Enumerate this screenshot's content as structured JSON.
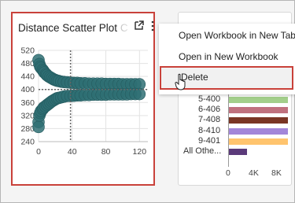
{
  "left_card": {
    "title_visible": "Distance Scatter Plot",
    "title_faded": " C",
    "icons": [
      "expand-icon",
      "kebab-menu-icon"
    ]
  },
  "chart_data": {
    "type": "scatter",
    "title": "Distance Scatter Plot",
    "xlim": [
      0,
      130
    ],
    "ylim": [
      240,
      520
    ],
    "xticks": [
      "0",
      "40",
      "80",
      "120"
    ],
    "yticks": [
      "520",
      "480",
      "440",
      "400",
      "360",
      "320",
      "280",
      "240"
    ],
    "grid": true,
    "reference_lines": {
      "x": 38,
      "y": 400
    },
    "color": "#2e6e73",
    "points": [
      [
        0,
        490
      ],
      [
        1,
        478
      ],
      [
        2,
        470
      ],
      [
        3,
        466
      ],
      [
        5,
        460
      ],
      [
        6,
        456
      ],
      [
        7,
        452
      ],
      [
        9,
        447
      ],
      [
        10,
        444
      ],
      [
        12,
        440
      ],
      [
        14,
        437
      ],
      [
        16,
        434
      ],
      [
        18,
        431
      ],
      [
        20,
        429
      ],
      [
        22,
        427
      ],
      [
        24,
        426
      ],
      [
        27,
        424
      ],
      [
        30,
        423
      ],
      [
        34,
        422
      ],
      [
        38,
        421
      ],
      [
        42,
        420
      ],
      [
        46,
        420
      ],
      [
        50,
        419
      ],
      [
        55,
        419
      ],
      [
        60,
        418
      ],
      [
        65,
        418
      ],
      [
        70,
        418
      ],
      [
        75,
        418
      ],
      [
        80,
        417
      ],
      [
        85,
        417
      ],
      [
        90,
        417
      ],
      [
        95,
        417
      ],
      [
        100,
        416
      ],
      [
        105,
        416
      ],
      [
        110,
        416
      ],
      [
        115,
        416
      ],
      [
        120,
        416
      ],
      [
        0,
        300
      ],
      [
        0,
        285
      ],
      [
        1,
        320
      ],
      [
        2,
        328
      ],
      [
        3,
        334
      ],
      [
        5,
        340
      ],
      [
        6,
        344
      ],
      [
        8,
        348
      ],
      [
        10,
        352
      ],
      [
        12,
        356
      ],
      [
        14,
        360
      ],
      [
        16,
        364
      ],
      [
        18,
        367
      ],
      [
        20,
        370
      ],
      [
        22,
        373
      ],
      [
        24,
        374
      ],
      [
        27,
        376
      ],
      [
        30,
        378
      ],
      [
        34,
        380
      ],
      [
        38,
        380
      ],
      [
        42,
        381
      ],
      [
        46,
        382
      ],
      [
        50,
        382
      ],
      [
        55,
        383
      ],
      [
        60,
        383
      ],
      [
        65,
        384
      ],
      [
        70,
        384
      ],
      [
        75,
        384
      ],
      [
        80,
        384
      ],
      [
        85,
        385
      ],
      [
        90,
        385
      ],
      [
        95,
        385
      ],
      [
        100,
        385
      ],
      [
        105,
        385
      ],
      [
        110,
        386
      ],
      [
        115,
        386
      ],
      [
        120,
        386
      ]
    ]
  },
  "right_card": {
    "bars": [
      {
        "label": "5-400",
        "value": 0.95,
        "color": "#a3cf8b"
      },
      {
        "label": "6-406",
        "value": 0.95,
        "color": "#c0717e"
      },
      {
        "label": "7-408",
        "value": 0.95,
        "color": "#7a3524"
      },
      {
        "label": "8-410",
        "value": 0.95,
        "color": "#a386d9"
      },
      {
        "label": "9-401",
        "value": 0.95,
        "color": "#ffc46e"
      },
      {
        "label": "All Othe...",
        "value": 0.3,
        "color": "#5b3a7a"
      }
    ],
    "axis_ticks": [
      "0",
      "4K",
      "8K"
    ]
  },
  "menu": {
    "items": [
      {
        "label": "Open Workbook in New Tab"
      },
      {
        "label": "Open in New Workbook"
      },
      {
        "label": "Delete"
      }
    ]
  }
}
